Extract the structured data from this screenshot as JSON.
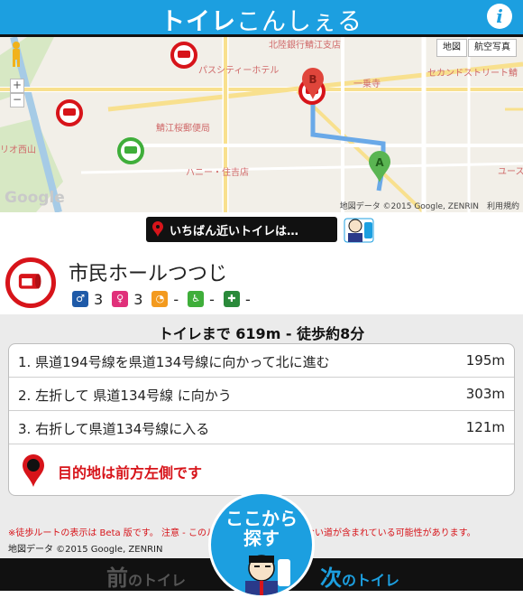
{
  "header": {
    "logo_bold": "トイレ",
    "logo_rest": "こんしぇる",
    "info_label": "i"
  },
  "map": {
    "buttons": [
      "地図",
      "航空写真"
    ],
    "labels": [
      "北陸銀行鯖江支店",
      "パスシティーホテル",
      "一乗寺",
      "セカンドストリート鯖",
      "鯖江桜郵便局",
      "リオ西山",
      "ハニー・住吉店",
      "ユース"
    ],
    "zoom_in": "+",
    "zoom_out": "−",
    "google": "Google",
    "credit": "地図データ ©2015 Google, ZENRIN　利用規約",
    "marker_a": "A",
    "marker_b": "B",
    "accent": "#1c9fe0"
  },
  "nearest": {
    "text": "いちばん近いトイレは…"
  },
  "toilet": {
    "name": "市民ホールつつじ",
    "features": [
      {
        "icon": "male-icon",
        "color": "#1e5aa8",
        "value": "3"
      },
      {
        "icon": "female-icon",
        "color": "#e0307a",
        "value": "3"
      },
      {
        "icon": "baby-icon",
        "color": "#f39a1e",
        "value": "-"
      },
      {
        "icon": "wheelchair-icon",
        "color": "#3fae3a",
        "value": "-"
      },
      {
        "icon": "ostomate-icon",
        "color": "#2a8a3a",
        "value": "-"
      }
    ]
  },
  "directions": {
    "summary": "トイレまで 619m - 徒歩約8分",
    "steps": [
      {
        "text": "1. 県道194号線を県道134号線に向かって北に進む",
        "distance": "195m"
      },
      {
        "text": "2. 左折して 県道134号線 に向かう",
        "distance": "303m"
      },
      {
        "text": "3. 右折して県道134号線に入る",
        "distance": "121m"
      }
    ],
    "destination": "目的地は前方左側です",
    "note": "※徒歩ルートの表示は Beta 版です。 注意 - このルートには歩行者専用でない道が含まれている可能性があります。",
    "credit": "地図データ ©2015 Google, ZENRIN"
  },
  "nav": {
    "prev_big": "前",
    "prev_small": "のトイレ",
    "next_big": "次",
    "next_small": "のトイレ",
    "search_line1": "ここから",
    "search_line2": "探す"
  }
}
